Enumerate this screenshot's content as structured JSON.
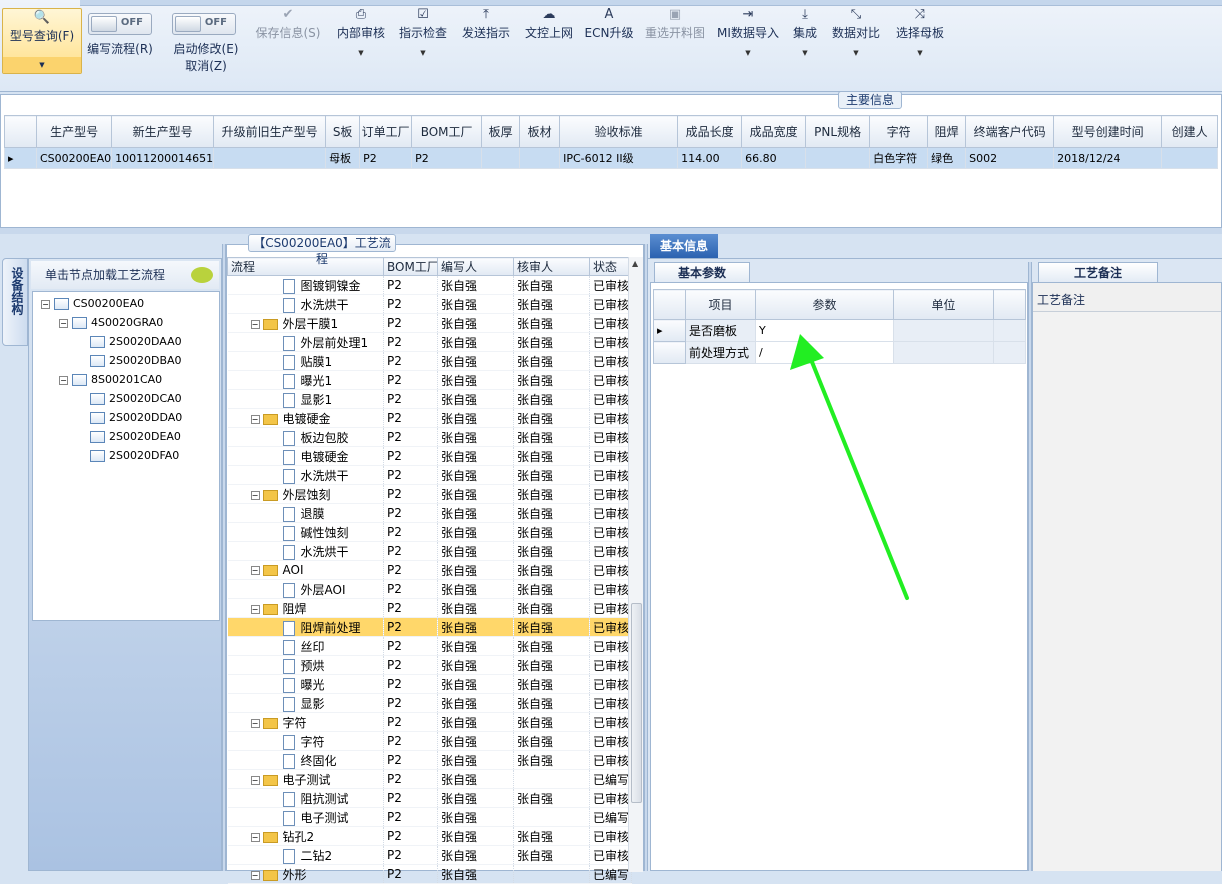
{
  "ribbon": {
    "buttons": [
      {
        "label": "型号查询(F)",
        "icon": "magnifier-icon"
      },
      {
        "label": "编写流程(R)",
        "icon": "toggle"
      },
      {
        "label": "启动修改(E)",
        "label2": "取消(Z)",
        "icon": "toggle"
      },
      {
        "label": "保存信息(S)",
        "icon": "checkmark-icon",
        "disabled": true
      },
      {
        "label": "内部审核",
        "icon": "printer-icon"
      },
      {
        "label": "指示检查",
        "icon": "checkbox-icon"
      },
      {
        "label": "发送指示",
        "icon": "upload-icon"
      },
      {
        "label": "文控上网",
        "icon": "cloud-upload-icon"
      },
      {
        "label": "ECN升级",
        "icon": "font-a-icon"
      },
      {
        "label": "重选开料图",
        "icon": "image-icon",
        "disabled": true
      },
      {
        "label": "MI数据导入",
        "icon": "import-icon"
      },
      {
        "label": "集成",
        "icon": "download-icon"
      },
      {
        "label": "数据对比",
        "icon": "compress-icon"
      },
      {
        "label": "选择母板",
        "icon": "shuffle-icon"
      }
    ],
    "toggle_text": "OFF"
  },
  "main_info": {
    "title": "主要信息",
    "columns": [
      "生产型号",
      "新生产型号",
      "升级前旧生产型号",
      "S板",
      "订单工厂",
      "BOM工厂",
      "板厚",
      "板材",
      "验收标准",
      "成品长度",
      "成品宽度",
      "PNL规格",
      "字符",
      "阻焊",
      "终端客户代码",
      "型号创建时间",
      "创建人"
    ],
    "rows": [
      [
        "CS00200EA0",
        "10011200014651",
        "",
        "母板",
        "P2",
        "P2",
        "",
        "",
        "IPC-6012 II级",
        "114.00",
        "66.80",
        "",
        "白色字符",
        "绿色",
        "S002",
        "2018/12/24",
        ""
      ]
    ]
  },
  "left_panel": {
    "tab_label": "设备结构",
    "header": "单击节点加载工艺流程",
    "tree": [
      {
        "label": "CS00200EA0",
        "level": 0,
        "box": "−"
      },
      {
        "label": "4S0020GRA0",
        "level": 1,
        "box": "−"
      },
      {
        "label": "2S0020DAA0",
        "level": 2
      },
      {
        "label": "2S0020DBA0",
        "level": 2
      },
      {
        "label": "8S00201CA0",
        "level": 1,
        "box": "−"
      },
      {
        "label": "2S0020DCA0",
        "level": 2
      },
      {
        "label": "2S0020DDA0",
        "level": 2
      },
      {
        "label": "2S0020DEA0",
        "level": 2
      },
      {
        "label": "2S0020DFA0",
        "level": 2
      }
    ]
  },
  "process": {
    "title": "【CS00200EA0】工艺流程",
    "columns": [
      "流程",
      "BOM工厂",
      "编写人",
      "核审人",
      "状态"
    ],
    "rows": [
      {
        "name": "图镀铜镍金",
        "level": 1,
        "bom": "P2",
        "writer": "张自强",
        "reviewer": "张自强",
        "status": "已审核"
      },
      {
        "name": "水洗烘干",
        "level": 1,
        "bom": "P2",
        "writer": "张自强",
        "reviewer": "张自强",
        "status": "已审核"
      },
      {
        "name": "外层干膜1",
        "level": 0,
        "bom": "P2",
        "writer": "张自强",
        "reviewer": "张自强",
        "status": "已审核"
      },
      {
        "name": "外层前处理1",
        "level": 1,
        "bom": "P2",
        "writer": "张自强",
        "reviewer": "张自强",
        "status": "已审核"
      },
      {
        "name": "贴膜1",
        "level": 1,
        "bom": "P2",
        "writer": "张自强",
        "reviewer": "张自强",
        "status": "已审核"
      },
      {
        "name": "曝光1",
        "level": 1,
        "bom": "P2",
        "writer": "张自强",
        "reviewer": "张自强",
        "status": "已审核"
      },
      {
        "name": "显影1",
        "level": 1,
        "bom": "P2",
        "writer": "张自强",
        "reviewer": "张自强",
        "status": "已审核"
      },
      {
        "name": "电镀硬金",
        "level": 0,
        "bom": "P2",
        "writer": "张自强",
        "reviewer": "张自强",
        "status": "已审核"
      },
      {
        "name": "板边包胶",
        "level": 1,
        "bom": "P2",
        "writer": "张自强",
        "reviewer": "张自强",
        "status": "已审核"
      },
      {
        "name": "电镀硬金",
        "level": 1,
        "bom": "P2",
        "writer": "张自强",
        "reviewer": "张自强",
        "status": "已审核"
      },
      {
        "name": "水洗烘干",
        "level": 1,
        "bom": "P2",
        "writer": "张自强",
        "reviewer": "张自强",
        "status": "已审核"
      },
      {
        "name": "外层蚀刻",
        "level": 0,
        "bom": "P2",
        "writer": "张自强",
        "reviewer": "张自强",
        "status": "已审核"
      },
      {
        "name": "退膜",
        "level": 1,
        "bom": "P2",
        "writer": "张自强",
        "reviewer": "张自强",
        "status": "已审核"
      },
      {
        "name": "碱性蚀刻",
        "level": 1,
        "bom": "P2",
        "writer": "张自强",
        "reviewer": "张自强",
        "status": "已审核"
      },
      {
        "name": "水洗烘干",
        "level": 1,
        "bom": "P2",
        "writer": "张自强",
        "reviewer": "张自强",
        "status": "已审核"
      },
      {
        "name": "AOI",
        "level": 0,
        "bom": "P2",
        "writer": "张自强",
        "reviewer": "张自强",
        "status": "已审核"
      },
      {
        "name": "外层AOI",
        "level": 1,
        "bom": "P2",
        "writer": "张自强",
        "reviewer": "张自强",
        "status": "已审核"
      },
      {
        "name": "阻焊",
        "level": 0,
        "bom": "P2",
        "writer": "张自强",
        "reviewer": "张自强",
        "status": "已审核"
      },
      {
        "name": "阻焊前处理",
        "level": 1,
        "bom": "P2",
        "writer": "张自强",
        "reviewer": "张自强",
        "status": "已审核",
        "selected": true
      },
      {
        "name": "丝印",
        "level": 1,
        "bom": "P2",
        "writer": "张自强",
        "reviewer": "张自强",
        "status": "已审核"
      },
      {
        "name": "预烘",
        "level": 1,
        "bom": "P2",
        "writer": "张自强",
        "reviewer": "张自强",
        "status": "已审核"
      },
      {
        "name": "曝光",
        "level": 1,
        "bom": "P2",
        "writer": "张自强",
        "reviewer": "张自强",
        "status": "已审核"
      },
      {
        "name": "显影",
        "level": 1,
        "bom": "P2",
        "writer": "张自强",
        "reviewer": "张自强",
        "status": "已审核"
      },
      {
        "name": "字符",
        "level": 0,
        "bom": "P2",
        "writer": "张自强",
        "reviewer": "张自强",
        "status": "已审核"
      },
      {
        "name": "字符",
        "level": 1,
        "bom": "P2",
        "writer": "张自强",
        "reviewer": "张自强",
        "status": "已审核"
      },
      {
        "name": "终固化",
        "level": 1,
        "bom": "P2",
        "writer": "张自强",
        "reviewer": "张自强",
        "status": "已审核"
      },
      {
        "name": "电子测试",
        "level": 0,
        "bom": "P2",
        "writer": "张自强",
        "reviewer": "",
        "status": "已编写"
      },
      {
        "name": "阻抗测试",
        "level": 1,
        "bom": "P2",
        "writer": "张自强",
        "reviewer": "张自强",
        "status": "已审核"
      },
      {
        "name": "电子测试",
        "level": 1,
        "bom": "P2",
        "writer": "张自强",
        "reviewer": "",
        "status": "已编写"
      },
      {
        "name": "钻孔2",
        "level": 0,
        "bom": "P2",
        "writer": "张自强",
        "reviewer": "张自强",
        "status": "已审核"
      },
      {
        "name": "二钻2",
        "level": 1,
        "bom": "P2",
        "writer": "张自强",
        "reviewer": "张自强",
        "status": "已审核"
      },
      {
        "name": "外形",
        "level": 0,
        "bom": "P2",
        "writer": "张自强",
        "reviewer": "",
        "status": "已编写"
      }
    ]
  },
  "basic_info": {
    "tab": "基本信息",
    "params_tab": "基本参数",
    "columns": [
      "项目",
      "参数",
      "单位"
    ],
    "rows": [
      {
        "item": "是否磨板",
        "value": "Y",
        "unit": ""
      },
      {
        "item": "前处理方式",
        "value": "/",
        "unit": ""
      }
    ],
    "remark_tab": "工艺备注",
    "remark_label": "工艺备注"
  },
  "colors": {
    "accent": "#2b62b0",
    "selected_row": "#ffd76a",
    "annotation_arrow": "#22ee22"
  }
}
